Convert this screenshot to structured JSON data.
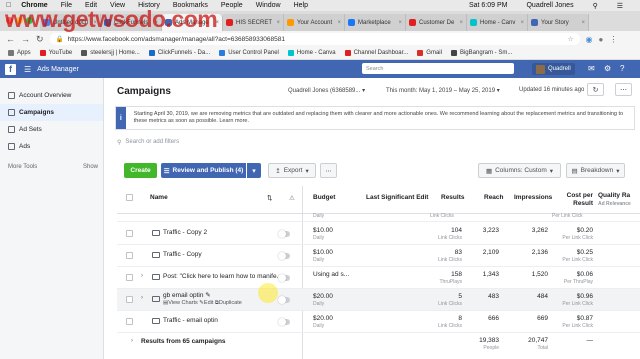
{
  "watermark": "www.getwsodo.com",
  "menubar": {
    "app": "Chrome",
    "items": [
      "File",
      "Edit",
      "View",
      "History",
      "Bookmarks",
      "People",
      "Window",
      "Help"
    ],
    "clock": "Sat 6:09 PM",
    "user": "Quadrell Jones"
  },
  "tabs": [
    {
      "label": "Untitled docu",
      "color": "#4285f4"
    },
    {
      "label": "ClickFunnels",
      "color": "#1b6ac9"
    },
    {
      "label": "Ads Manage",
      "color": "#4267b2",
      "active": true
    },
    {
      "label": "HIS SECRET",
      "color": "#e02020"
    },
    {
      "label": "Your Account",
      "color": "#ff9900"
    },
    {
      "label": "Marketplace",
      "color": "#1877f2"
    },
    {
      "label": "Customer De",
      "color": "#e02020"
    },
    {
      "label": "Home - Canv",
      "color": "#00c4cc"
    },
    {
      "label": "Your Story",
      "color": "#4267b2"
    }
  ],
  "address": {
    "url": "https://www.facebook.com/adsmanager/manage/all?act=636858933068581"
  },
  "bookmarks": [
    {
      "label": "Apps",
      "color": "#777"
    },
    {
      "label": "YouTube",
      "color": "#e02020"
    },
    {
      "label": "steelersjj | Home...",
      "color": "#555"
    },
    {
      "label": "ClickFunnels - Da...",
      "color": "#1b6ac9"
    },
    {
      "label": "User Control Panel",
      "color": "#2a7ae2"
    },
    {
      "label": "Home - Canva",
      "color": "#00c4cc"
    },
    {
      "label": "Channel Dashboar...",
      "color": "#e02020"
    },
    {
      "label": "Gmail",
      "color": "#d93025"
    },
    {
      "label": "BigBangram - Sm...",
      "color": "#444"
    }
  ],
  "fb": {
    "app_title": "Ads Manager",
    "search_placeholder": "Search",
    "user": "Quadrell"
  },
  "sidebar": {
    "items": [
      {
        "label": "Account Overview"
      },
      {
        "label": "Campaigns",
        "active": true
      },
      {
        "label": "Ad Sets"
      },
      {
        "label": "Ads"
      }
    ],
    "more_tools": "More Tools",
    "show": "Show"
  },
  "header": {
    "title": "Campaigns",
    "account": "Quadrell Jones (6368589...",
    "date_range": "This month: May 1, 2019 – May 25, 2019",
    "updated": "Updated 16 minutes ago"
  },
  "notice": "Starting April 30, 2019, we are removing metrics that are outdated and replacing them with clearer and more actionable ones. We recommend learning about the replacement metrics and transitioning to these metrics as soon as possible. Learn more.",
  "filter_placeholder": "Search or add filters",
  "toolbar": {
    "create": "Create",
    "review": "Review and Publish (4)",
    "export": "Export",
    "columns": "Columns: Custom",
    "breakdown": "Breakdown"
  },
  "columns": {
    "name": "Name",
    "budget": "Budget",
    "last_edit": "Last Significant Edit",
    "results": "Results",
    "reach": "Reach",
    "impressions": "Impressions",
    "cpr": "Cost per Result",
    "quality": "Quality Ra",
    "quality_sub": "Ad Relevance"
  },
  "partial_row": {
    "budget_sub": "Daily",
    "results_sub": "Link Clicks",
    "cpr_sub": "Per Link Click"
  },
  "rows": [
    {
      "name": "Traffic - Copy 2",
      "budget": "$10.00",
      "budget_sub": "Daily",
      "results": "104",
      "results_sub": "Link Clicks",
      "reach": "3,223",
      "impressions": "3,262",
      "cpr": "$0.20",
      "cpr_sub": "Per Link Click",
      "expand": false,
      "highlight": false
    },
    {
      "name": "Traffic - Copy",
      "budget": "$10.00",
      "budget_sub": "Daily",
      "results": "83",
      "results_sub": "Link Clicks",
      "reach": "2,109",
      "impressions": "2,136",
      "cpr": "$0.25",
      "cpr_sub": "Per Link Click",
      "expand": false,
      "highlight": false
    },
    {
      "name": "Post: \"Click here to learn how to manife...",
      "budget": "Using ad s...",
      "budget_sub": "",
      "results": "158",
      "results_sub": "ThruPlays",
      "reach": "1,343",
      "impressions": "1,520",
      "cpr": "$0.06",
      "cpr_sub": "Per ThruPlay",
      "expand": true,
      "highlight": false
    },
    {
      "name": "gb email optin",
      "budget": "$20.00",
      "budget_sub": "Daily",
      "results": "5",
      "results_sub": "Link Clicks",
      "reach": "483",
      "impressions": "484",
      "cpr": "$0.96",
      "cpr_sub": "Per Link Click",
      "expand": true,
      "highlight": true,
      "actions": [
        "View Charts",
        "Edit",
        "Duplicate"
      ]
    },
    {
      "name": "Traffic - email optin",
      "budget": "$20.00",
      "budget_sub": "Daily",
      "results": "8",
      "results_sub": "Link Clicks",
      "reach": "666",
      "impressions": "669",
      "cpr": "$0.87",
      "cpr_sub": "Per Link Click",
      "expand": false,
      "highlight": false
    }
  ],
  "summary": {
    "label": "Results from 65 campaigns",
    "reach": "19,383",
    "reach_sub": "People",
    "impressions": "20,747",
    "impressions_sub": "Total",
    "cpr": "—"
  }
}
